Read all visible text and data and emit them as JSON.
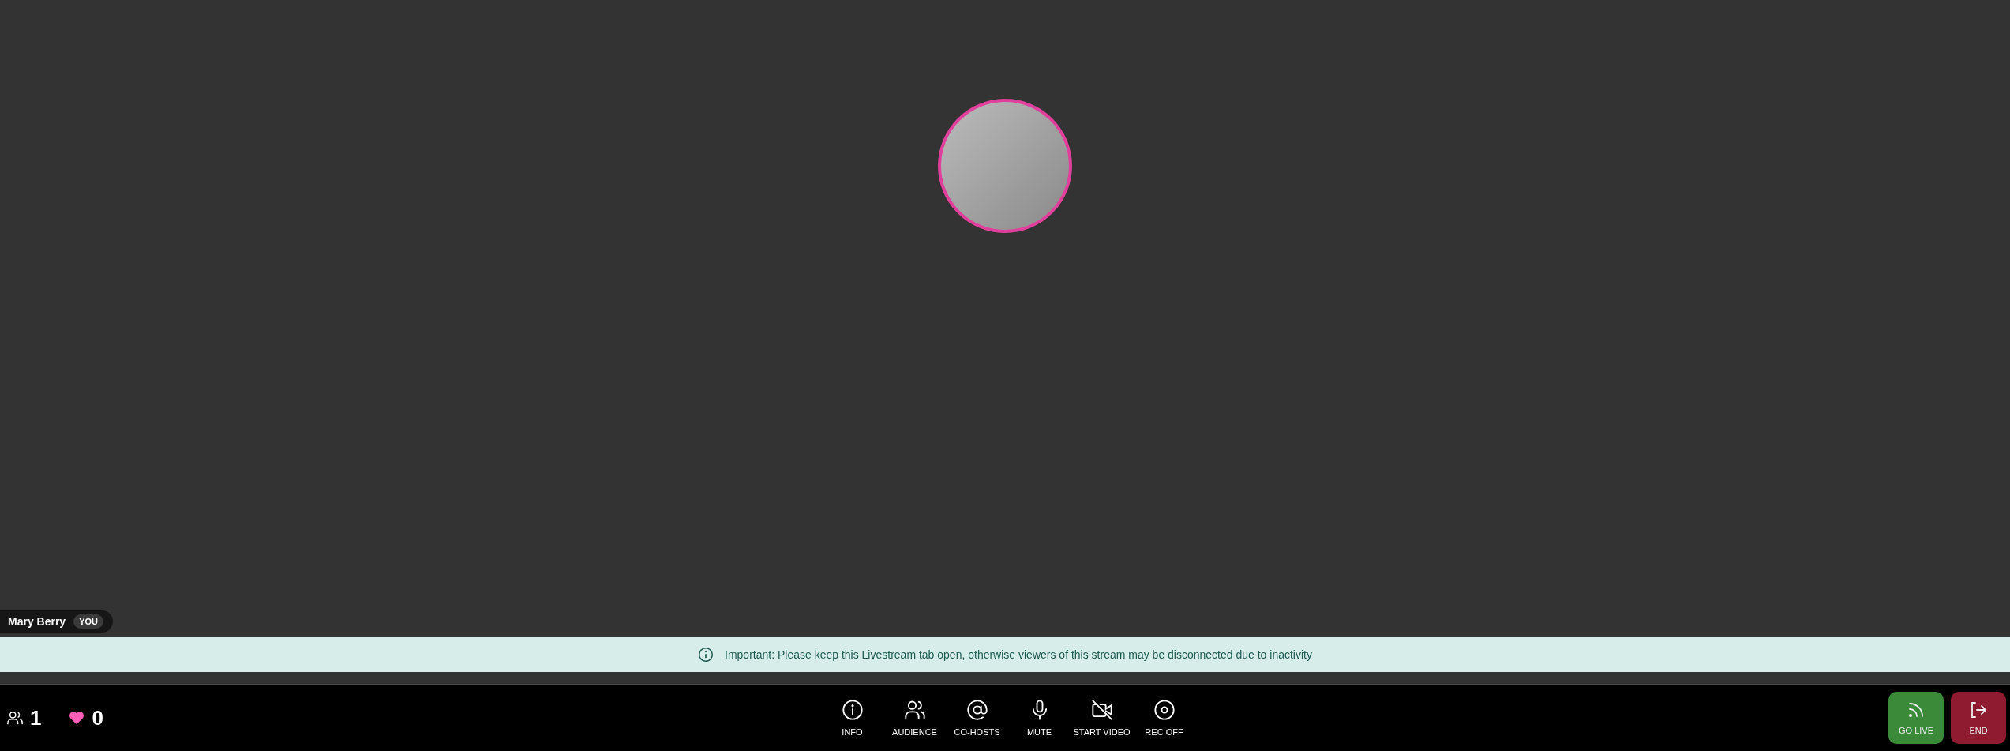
{
  "participant": {
    "name": "Mary Berry",
    "badge": "YOU"
  },
  "notice": {
    "text": "Important: Please keep this Livestream tab open, otherwise viewers of this stream may be disconnected due to inactivity"
  },
  "stats": {
    "viewers": "1",
    "likes": "0"
  },
  "toolbar": [
    {
      "kind": "info",
      "label": "INFO"
    },
    {
      "kind": "audience",
      "label": "AUDIENCE"
    },
    {
      "kind": "cohosts",
      "label": "CO-HOSTS"
    },
    {
      "kind": "mic",
      "label": "MUTE"
    },
    {
      "kind": "video-off",
      "label": "START VIDEO"
    },
    {
      "kind": "record",
      "label": "REC OFF"
    }
  ],
  "actions": [
    {
      "kind": "live",
      "label": "GO LIVE"
    },
    {
      "kind": "end",
      "label": "END"
    }
  ]
}
